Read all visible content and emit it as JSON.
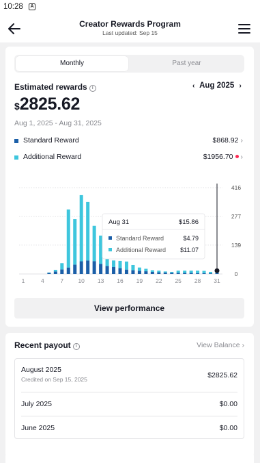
{
  "status_bar": {
    "time": "10:28",
    "notification_icon": "A"
  },
  "header": {
    "title": "Creator Rewards Program",
    "subtitle": "Last updated: Sep 15",
    "back_icon": "arrow-left-icon",
    "menu_icon": "hamburger-icon"
  },
  "tabs": [
    {
      "label": "Monthly",
      "active": true
    },
    {
      "label": "Past year",
      "active": false
    }
  ],
  "summary": {
    "label": "Estimated rewards",
    "month": "Aug 2025",
    "currency_symbol": "$",
    "amount": "2825.62",
    "date_range": "Aug 1, 2025 - Aug 31, 2025"
  },
  "legend": [
    {
      "label": "Standard Reward",
      "amount": "$868.92",
      "color": "#1b5fa8",
      "alert": false
    },
    {
      "label": "Additional Reward",
      "amount": "$1956.70",
      "color": "#3ec6dd",
      "alert": true
    }
  ],
  "chart_data": {
    "type": "bar",
    "stacked": true,
    "x_ticks": [
      "1",
      "4",
      "7",
      "10",
      "13",
      "16",
      "19",
      "22",
      "25",
      "28",
      "31"
    ],
    "y_ticks": [
      "416",
      "277",
      "139",
      "0"
    ],
    "ylim": [
      0,
      416
    ],
    "categories": [
      1,
      2,
      3,
      4,
      5,
      6,
      7,
      8,
      9,
      10,
      11,
      12,
      13,
      14,
      15,
      16,
      17,
      18,
      19,
      20,
      21,
      22,
      23,
      24,
      25,
      26,
      27,
      28,
      29,
      30,
      31
    ],
    "series": [
      {
        "name": "Standard Reward",
        "color": "#1b5fa8",
        "values": [
          0,
          0,
          0,
          0,
          5,
          12,
          22,
          31,
          45,
          61,
          65,
          62,
          49,
          39,
          33,
          28,
          21,
          18,
          15,
          13,
          10,
          8,
          7,
          6,
          6,
          5,
          5,
          4,
          4,
          3,
          4.79
        ]
      },
      {
        "name": "Additional Reward",
        "color": "#3ec6dd",
        "values": [
          0,
          0,
          0,
          0,
          2,
          8,
          30,
          280,
          219,
          319,
          282,
          170,
          136,
          39,
          32,
          35,
          39,
          25,
          16,
          12,
          8,
          8,
          5,
          4,
          10,
          11,
          11,
          12,
          11,
          7,
          11.07
        ]
      }
    ],
    "grid": true,
    "tooltip": {
      "date": "Aug 31",
      "total": "$15.86",
      "rows": [
        {
          "label": "Standard Reward",
          "value": "$4.79",
          "color": "#1b5fa8"
        },
        {
          "label": "Additional Reward",
          "value": "$11.07",
          "color": "#3ec6dd"
        }
      ]
    }
  },
  "view_performance_label": "View performance",
  "recent_payout": {
    "title": "Recent payout",
    "view_balance_label": "View Balance",
    "items": [
      {
        "name": "August 2025",
        "sub": "Credited on Sep 15, 2025",
        "amount": "$2825.62"
      },
      {
        "name": "July 2025",
        "sub": "",
        "amount": "$0.00"
      },
      {
        "name": "June 2025",
        "sub": "",
        "amount": "$0.00"
      }
    ]
  }
}
